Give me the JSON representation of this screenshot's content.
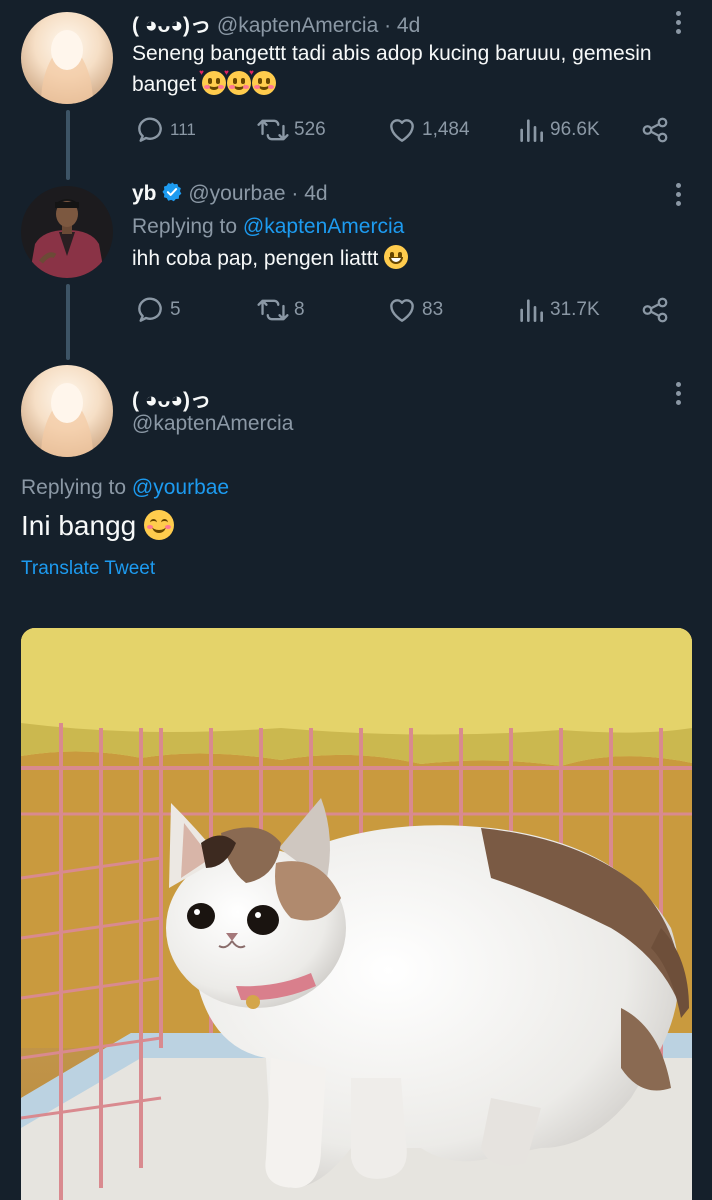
{
  "thread": [
    {
      "display_name": "( ◕ᴗ◕)っ",
      "handle": "@kaptenAmercia",
      "time": "· 4d",
      "text": "Seneng bangettt tadi abis adop kucing baruuu, gemesin banget",
      "emoji": [
        "smiling-face-with-hearts",
        "smiling-face-with-hearts",
        "smiling-face-with-hearts"
      ],
      "stats": {
        "replies": "111",
        "retweets": "526",
        "likes": "1,484",
        "views": "96.6K"
      }
    },
    {
      "display_name": "yb",
      "verified": true,
      "handle": "@yourbae",
      "time": "· 4d",
      "replying_prefix": "Replying to",
      "replying_to": "@kaptenAmercia",
      "text": "ihh coba pap, pengen liattt",
      "emoji": [
        "grinning-face"
      ],
      "stats": {
        "replies": "5",
        "retweets": "8",
        "likes": "83",
        "views": "31.7K"
      }
    }
  ],
  "main_tweet": {
    "display_name": "( ◕ᴗ◕)っ",
    "handle": "@kaptenAmercia",
    "replying_prefix": "Replying to",
    "replying_to": "@yourbae",
    "text": "Ini bangg",
    "emoji": [
      "smiling-face-with-smiling-eyes"
    ],
    "translate_label": "Translate Tweet",
    "media": "photo of a white and brown cat inside a pink wire cage under a yellow blanket"
  },
  "colors": {
    "background": "#15202b",
    "text": "#f7f9f9",
    "muted": "#8b98a5",
    "accent": "#1d9bf0",
    "thread_line": "#3d5466"
  }
}
